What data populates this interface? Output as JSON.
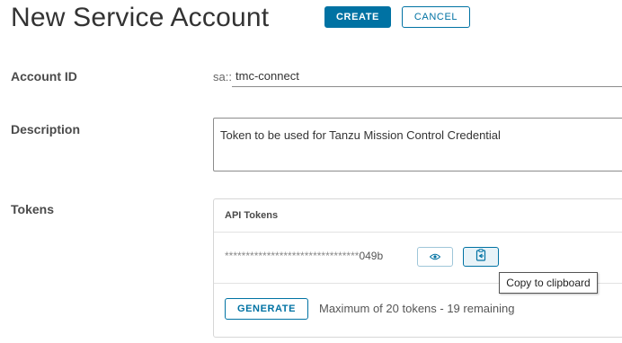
{
  "header": {
    "title": "New Service Account",
    "create_label": "CREATE",
    "cancel_label": "CANCEL"
  },
  "form": {
    "account_id": {
      "label": "Account ID",
      "prefix": "sa::",
      "value": "tmc-connect"
    },
    "description": {
      "label": "Description",
      "value": "Token to be used for Tanzu Mission Control Credential"
    },
    "tokens": {
      "label": "Tokens",
      "card_title": "API Tokens",
      "masked": "********************************",
      "suffix": "049b",
      "generate_label": "GENERATE",
      "limit_text": "Maximum of 20 tokens - 19 remaining",
      "tooltip": "Copy to clipboard"
    }
  },
  "icons": {
    "show": "eye-icon",
    "copy": "clipboard-icon"
  },
  "colors": {
    "accent": "#0072a3",
    "text": "#333333",
    "border": "#d6d6d6"
  }
}
